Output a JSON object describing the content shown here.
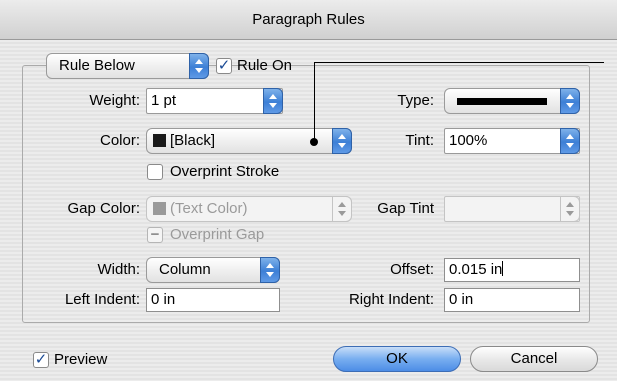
{
  "window": {
    "title": "Paragraph Rules"
  },
  "rule": {
    "selection": "Rule Below",
    "rule_on_label": "Rule On",
    "rule_on_checked": true
  },
  "fields": {
    "weight": {
      "label": "Weight:",
      "value": "1 pt"
    },
    "type": {
      "label": "Type:"
    },
    "color": {
      "label": "Color:",
      "value": "[Black]"
    },
    "tint": {
      "label": "Tint:",
      "value": "100%"
    },
    "overprint_stroke": {
      "label": "Overprint Stroke",
      "checked": false
    },
    "gap_color": {
      "label": "Gap Color:",
      "value": "(Text Color)"
    },
    "gap_tint": {
      "label": "Gap Tint",
      "value": ""
    },
    "overprint_gap": {
      "label": "Overprint Gap",
      "mark": "−"
    },
    "width": {
      "label": "Width:",
      "value": "Column"
    },
    "offset": {
      "label": "Offset:",
      "value": "0.015 in"
    },
    "left_indent": {
      "label": "Left Indent:",
      "value": "0 in"
    },
    "right_indent": {
      "label": "Right Indent:",
      "value": "0 in"
    }
  },
  "footer": {
    "preview_label": "Preview",
    "preview_checked": true,
    "ok_label": "OK",
    "cancel_label": "Cancel"
  },
  "colors": {
    "accent": "#4d8de6",
    "swatch_black": "#1a1a1a",
    "swatch_text_color": "#9a9a9a"
  }
}
